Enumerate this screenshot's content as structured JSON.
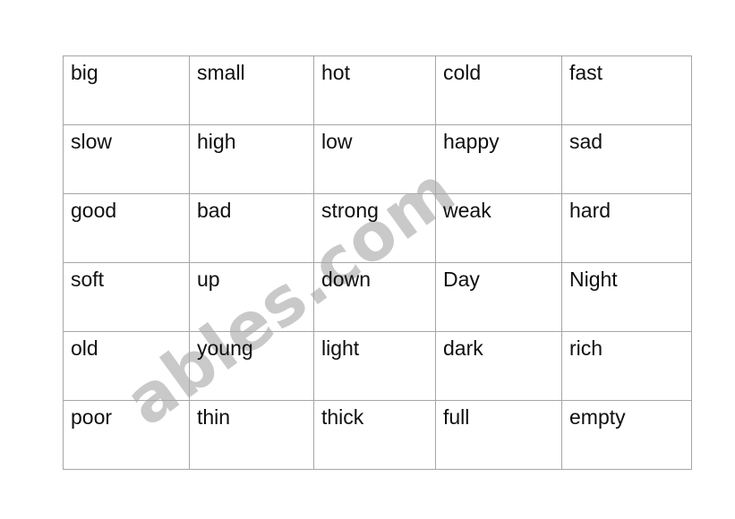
{
  "document": {
    "type": "worksheet",
    "title": "Opposites word table",
    "background_color": "#ffffff",
    "border_color": "#a6a6a6",
    "text_color": "#0f0f0f"
  },
  "watermark": {
    "text": "ables.com",
    "color": "#c9c9c9",
    "rotation_deg": -36
  },
  "table": {
    "rows": 6,
    "columns": 5,
    "cells": [
      [
        "big",
        "small",
        "hot",
        "cold",
        "fast"
      ],
      [
        "slow",
        "high",
        "low",
        "happy",
        "sad"
      ],
      [
        "good",
        "bad",
        "strong",
        "weak",
        "hard"
      ],
      [
        "soft",
        "up",
        "down",
        "Day",
        "Night"
      ],
      [
        "old",
        "young",
        "light",
        "dark",
        "rich"
      ],
      [
        "poor",
        "thin",
        "thick",
        "full",
        "empty"
      ]
    ],
    "small_font_cells": [
      [
        2,
        2
      ]
    ]
  }
}
